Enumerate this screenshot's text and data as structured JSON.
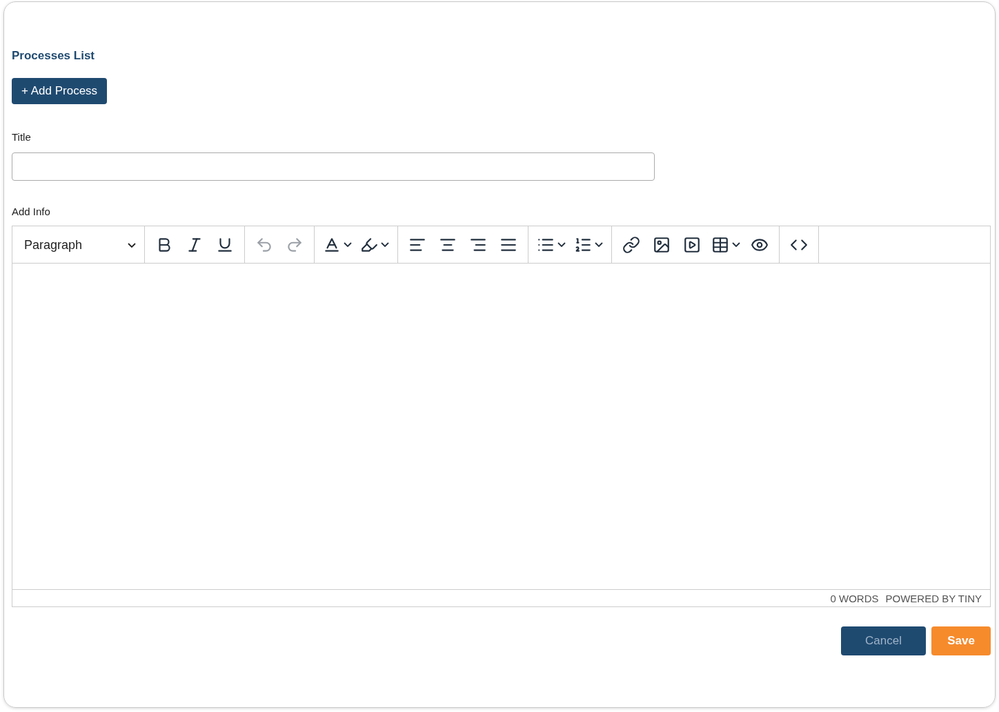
{
  "heading": "Processes List",
  "add_button": "+ Add Process",
  "title_field": {
    "label": "Title"
  },
  "editor": {
    "label": "Add Info",
    "format_select": "Paragraph",
    "toolbar_groups": [
      {
        "items": [
          {
            "kind": "button",
            "disabled": false
          },
          {
            "kind": "button",
            "disabled": false
          },
          {
            "kind": "button",
            "disabled": false
          }
        ]
      },
      {
        "items": [
          {
            "kind": "button",
            "disabled": true
          },
          {
            "kind": "button",
            "disabled": true
          }
        ]
      },
      {
        "items": [
          {
            "kind": "split",
            "disabled": false
          },
          {
            "kind": "split",
            "disabled": false
          }
        ]
      },
      {
        "items": [
          {
            "kind": "button",
            "disabled": false
          },
          {
            "kind": "button",
            "disabled": false
          },
          {
            "kind": "button",
            "disabled": false
          },
          {
            "kind": "button",
            "disabled": false
          }
        ]
      },
      {
        "items": [
          {
            "kind": "split",
            "disabled": false
          },
          {
            "kind": "split",
            "disabled": false
          }
        ]
      },
      {
        "items": [
          {
            "kind": "button",
            "disabled": false
          },
          {
            "kind": "button",
            "disabled": false
          },
          {
            "kind": "button",
            "disabled": false
          },
          {
            "kind": "split",
            "disabled": false
          },
          {
            "kind": "button",
            "disabled": false
          }
        ]
      },
      {
        "items": [
          {
            "kind": "button",
            "disabled": false
          }
        ]
      }
    ],
    "word_count": "0 WORDS",
    "branding": "POWERED BY TINY"
  },
  "actions": [
    {
      "kind": "secondary",
      "label": "Cancel"
    },
    {
      "kind": "primary",
      "label": "Save"
    }
  ]
}
